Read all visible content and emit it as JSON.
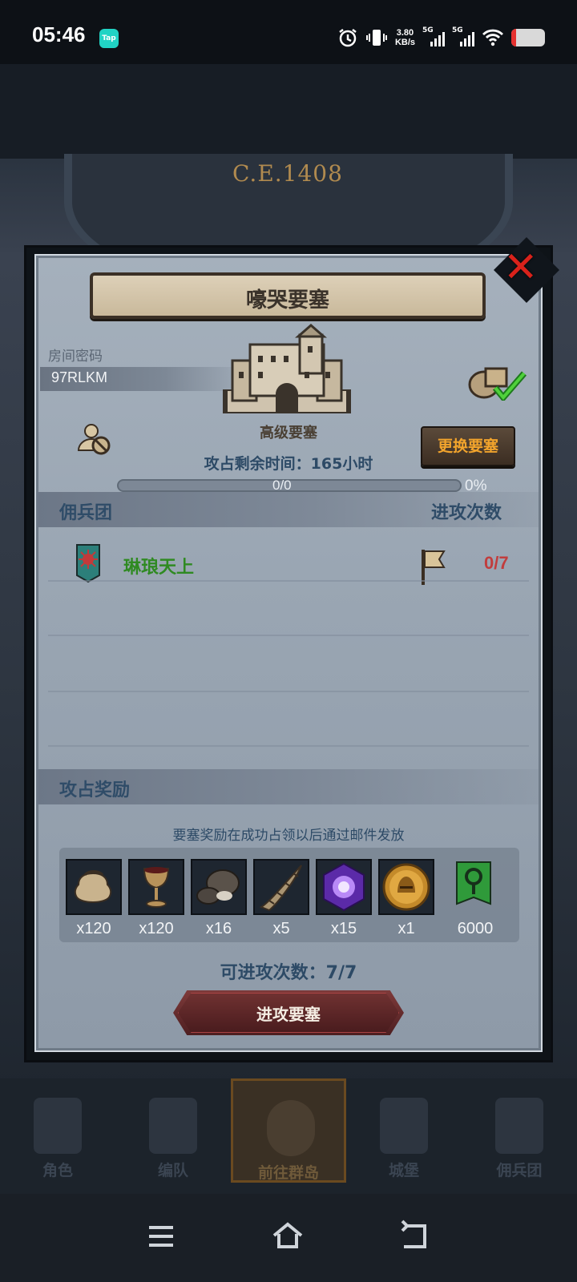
{
  "status_bar": {
    "time": "05:46",
    "app_badge": "Tap",
    "net_speed_value": "3.80",
    "net_speed_unit": "KB/s",
    "sim1": "5G",
    "sim2": "5G",
    "battery_level": 0.15,
    "icons": [
      "alarm-icon",
      "vibrate-icon",
      "signal-icon",
      "wifi-icon",
      "battery-icon"
    ]
  },
  "background": {
    "era": "C.E.1408"
  },
  "modal": {
    "title": "嚎哭要塞",
    "close_icon": "close-x-icon",
    "room_label": "房间密码",
    "room_code": "97RLKM",
    "fortress_type": "高级要塞",
    "change_button": "更换要塞",
    "remaining_time": "攻占剩余时间：165小时",
    "progress_text": "0/0",
    "progress_percent": "0%",
    "progress_value": 0,
    "guild_header": "佣兵团",
    "attack_header": "进攻次数",
    "guilds": [
      {
        "name": "琳琅天上",
        "attacks": "0/7"
      }
    ],
    "reward_header": "攻占奖励",
    "reward_note": "要塞奖励在成功占领以后通过邮件发放",
    "rewards": [
      {
        "icon": "pouch-icon",
        "qty": "x120"
      },
      {
        "icon": "goblet-icon",
        "qty": "x120"
      },
      {
        "icon": "truffle-icon",
        "qty": "x16"
      },
      {
        "icon": "horn-icon",
        "qty": "x5"
      },
      {
        "icon": "purple-gem-icon",
        "qty": "x15"
      },
      {
        "icon": "helmet-coin-icon",
        "qty": "x1"
      },
      {
        "icon": "tree-banner-icon",
        "qty": "6000"
      }
    ],
    "available_attacks": "可进攻次数：7/7",
    "attack_button": "进攻要塞"
  },
  "game_nav": {
    "items": [
      {
        "label": "角色",
        "icon": "character-icon"
      },
      {
        "label": "编队",
        "icon": "formation-icon"
      },
      {
        "label": "前往群岛",
        "icon": "islands-icon"
      },
      {
        "label": "城堡",
        "icon": "castle-icon"
      },
      {
        "label": "佣兵团",
        "icon": "mercenary-icon"
      }
    ]
  },
  "system_nav": {
    "icons": [
      "menu-icon",
      "home-icon",
      "back-icon"
    ]
  },
  "colors": {
    "accent_orange": "#f2a42c",
    "guild_green": "#2f8a22",
    "count_red": "#c13d3d",
    "close_red": "#d9221b"
  }
}
